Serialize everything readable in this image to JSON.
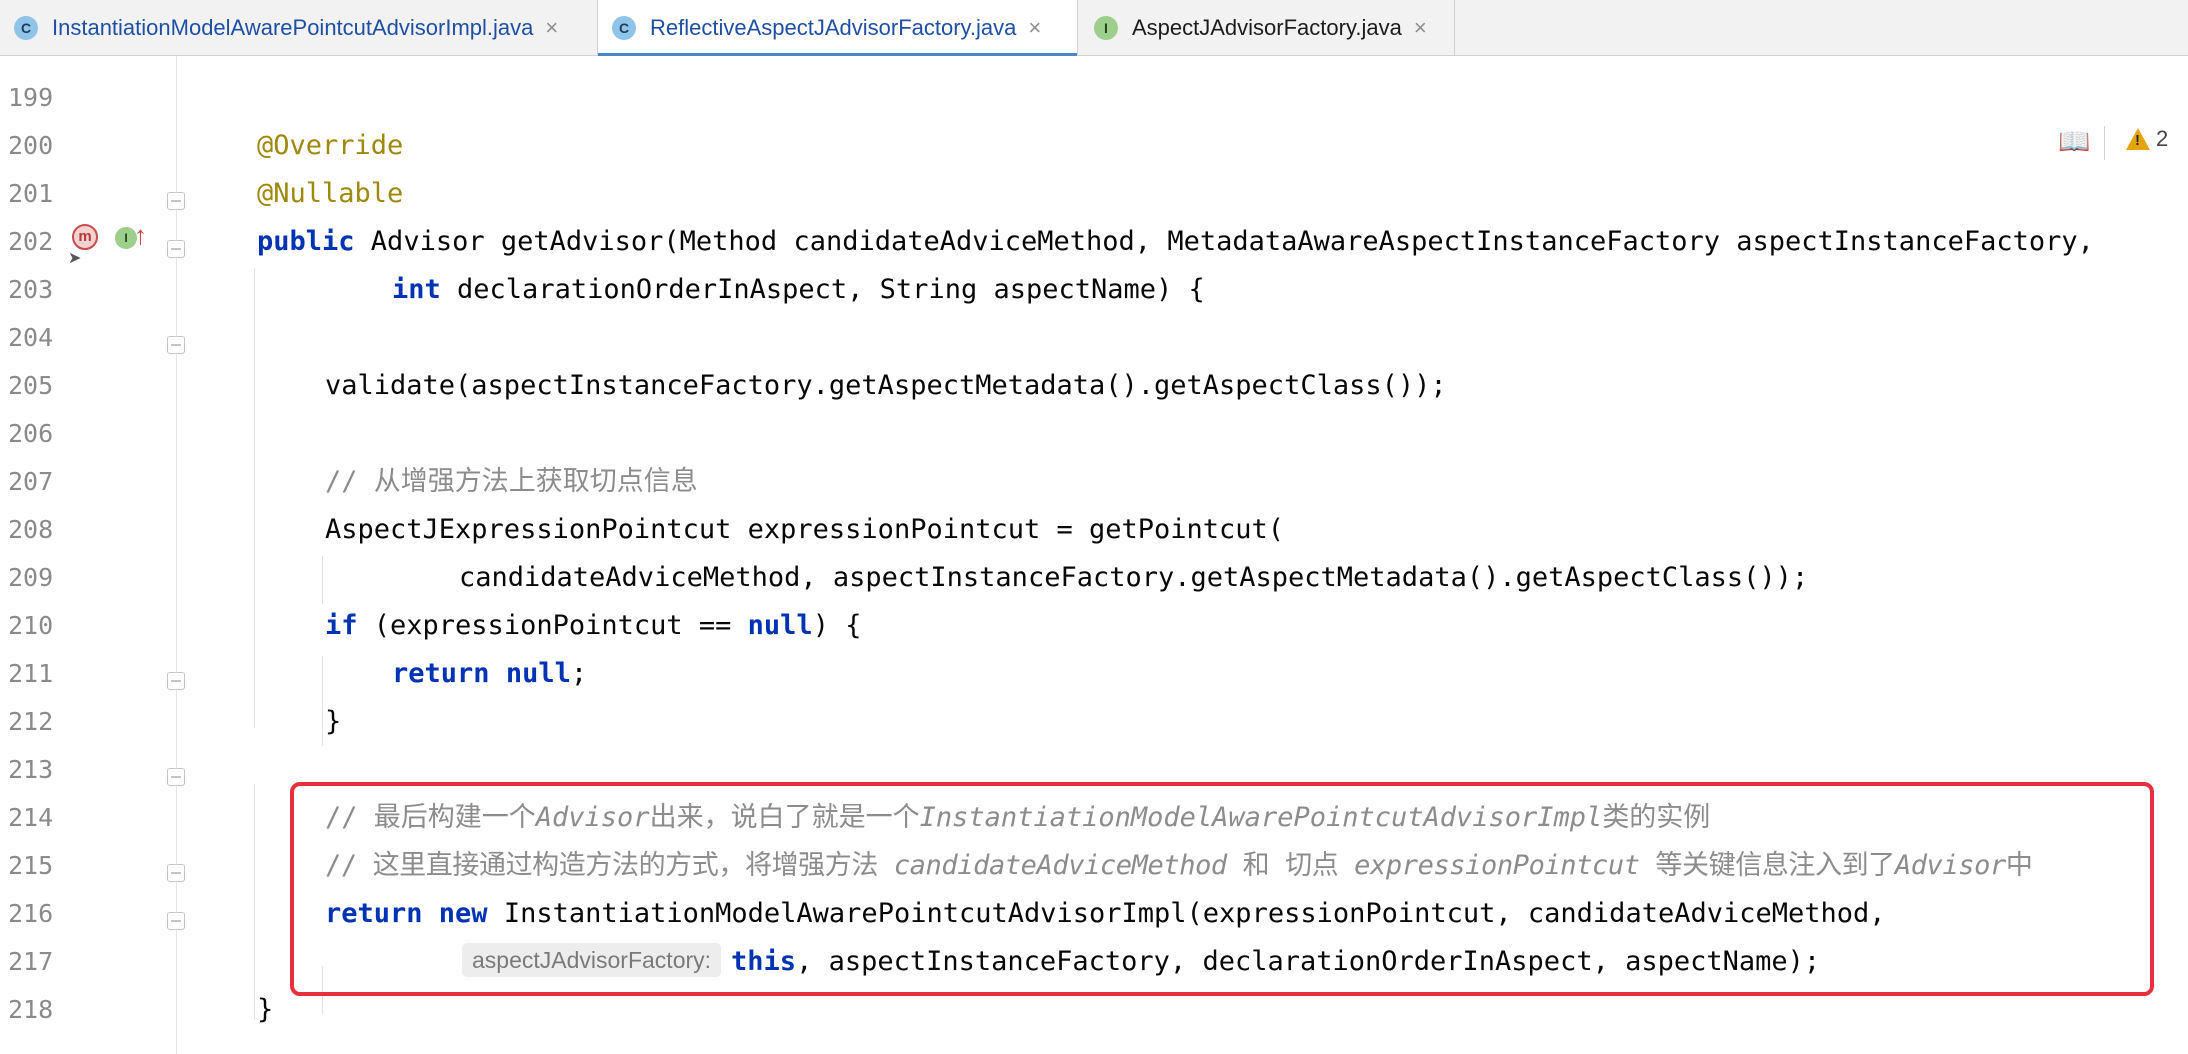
{
  "tabs": [
    {
      "label": "InstantiationModelAwarePointcutAdvisorImpl.java",
      "icon": "class-icon",
      "icon_letter": "C",
      "active": false
    },
    {
      "label": "ReflectiveAspectJAdvisorFactory.java",
      "icon": "class-icon",
      "icon_letter": "C",
      "active": true
    },
    {
      "label": "AspectJAdvisorFactory.java",
      "icon": "interface-icon",
      "icon_letter": "I",
      "active": false
    }
  ],
  "tab_close_glyph": "×",
  "toolbar": {
    "warning_count": "2",
    "reader_mode_icon": "reader-mode-icon",
    "warning_icon": "warning-icon"
  },
  "gutter": {
    "lines": [
      "199",
      "200",
      "201",
      "202",
      "203",
      "204",
      "205",
      "206",
      "207",
      "208",
      "209",
      "210",
      "211",
      "212",
      "213",
      "214",
      "215",
      "216",
      "217",
      "218"
    ],
    "method_icon_letter": "m",
    "implements_icon_letter": "I"
  },
  "code": {
    "l200": "@Override",
    "l201": "@Nullable",
    "l202_kw": "public",
    "l202_rest": " Advisor getAdvisor(Method candidateAdviceMethod, MetadataAwareAspectInstanceFactory aspectInstanceFactory,",
    "l203_kw": "int",
    "l203_rest": " declarationOrderInAspect, String aspectName) {",
    "l205": "validate(aspectInstanceFactory.getAspectMetadata().getAspectClass());",
    "l207": "// 从增强方法上获取切点信息",
    "l208": "AspectJExpressionPointcut expressionPointcut = getPointcut(",
    "l209": "candidateAdviceMethod, aspectInstanceFactory.getAspectMetadata().getAspectClass());",
    "l210_kw": "if",
    "l210_mid": " (expressionPointcut == ",
    "l210_kw2": "null",
    "l210_end": ") {",
    "l211_kw": "return",
    "l211_sp": " ",
    "l211_kw2": "null",
    "l211_end": ";",
    "l212": "}",
    "l214_a": "// 最后构建一个",
    "l214_b": "Advisor",
    "l214_c": "出来，说白了就是一个",
    "l214_d": "InstantiationModelAwarePointcutAdvisorImpl",
    "l214_e": "类的实例",
    "l215_a": "// 这里直接通过构造方法的方式，将增强方法 ",
    "l215_b": "candidateAdviceMethod",
    "l215_c": " 和 切点 ",
    "l215_d": "expressionPointcut",
    "l215_e": " 等关键信息注入到了",
    "l215_f": "Advisor",
    "l215_g": "中",
    "l216_kw": "return new",
    "l216_rest": " InstantiationModelAwarePointcutAdvisorImpl(expressionPointcut, candidateAdviceMethod,",
    "l217_hint": "aspectJAdvisorFactory:",
    "l217_kw": "this",
    "l217_rest": ", aspectInstanceFactory, declarationOrderInAspect, aspectName);",
    "l218": "}"
  }
}
